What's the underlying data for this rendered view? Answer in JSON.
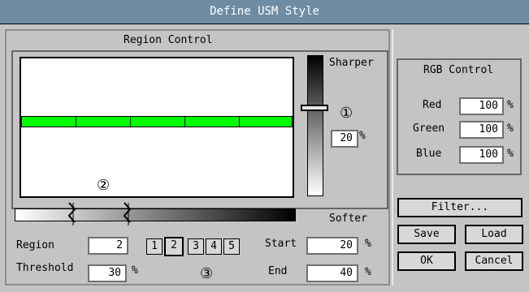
{
  "window": {
    "title": "Define USM Style"
  },
  "region_control": {
    "title": "Region Control",
    "marker_1": "①",
    "marker_2": "②",
    "marker_3": "③",
    "sharper_label": "Sharper",
    "softer_label": "Softer",
    "strength_value": "20",
    "percent": "%",
    "region_label": "Region",
    "region_value": "2",
    "threshold_label": "Threshold",
    "threshold_value": "30",
    "start_label": "Start",
    "start_value": "20",
    "end_label": "End",
    "end_value": "40",
    "region_buttons": [
      "1",
      "2",
      "3",
      "4",
      "5"
    ]
  },
  "rgb_control": {
    "title": "RGB Control",
    "red_label": "Red",
    "red_value": "100",
    "green_label": "Green",
    "green_value": "100",
    "blue_label": "Blue",
    "blue_value": "100",
    "percent": "%"
  },
  "buttons": {
    "filter": "Filter...",
    "save": "Save",
    "load": "Load",
    "ok": "OK",
    "cancel": "Cancel"
  },
  "colors": {
    "titlebar": "#6e8ca4",
    "green_band": "#00ff00"
  }
}
